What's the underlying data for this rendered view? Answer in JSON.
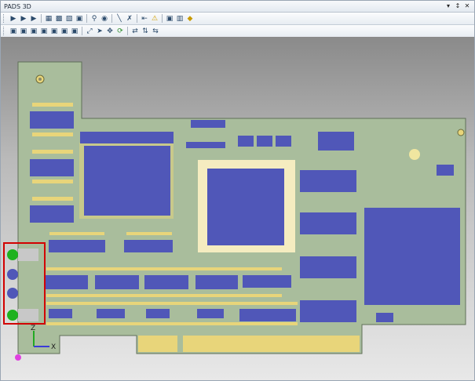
{
  "app": {
    "title": "PADS 3D",
    "window_controls": [
      "▾",
      "↕",
      "✕"
    ]
  },
  "toolbar1": {
    "icons": [
      "open-icon",
      "save-icon",
      "export-icon",
      "print-icon",
      "copy-icon",
      "paste-icon",
      "board-icon",
      "zoom-icon",
      "find-icon",
      "measure-icon",
      "probe-icon",
      "align-icon",
      "warning-icon",
      "camera-icon",
      "render-icon",
      "layers-icon"
    ]
  },
  "toolbar2": {
    "icons": [
      "view-top-icon",
      "view-bottom-icon",
      "view-left-icon",
      "view-right-icon",
      "view-front-icon",
      "view-back-icon",
      "view-iso-icon",
      "zoom-fit-icon",
      "select-icon",
      "pan-icon",
      "rotate-icon",
      "flip-horizontal-icon",
      "flip-vertical-icon",
      "mirror-icon"
    ]
  },
  "axes": {
    "x_label": "X",
    "z_label": "Z"
  },
  "colors": {
    "board": "#a9bd9c",
    "copper": "#e8d57a",
    "component": "#5057b8",
    "selection": "#d20000",
    "led": "#1fb21f"
  }
}
